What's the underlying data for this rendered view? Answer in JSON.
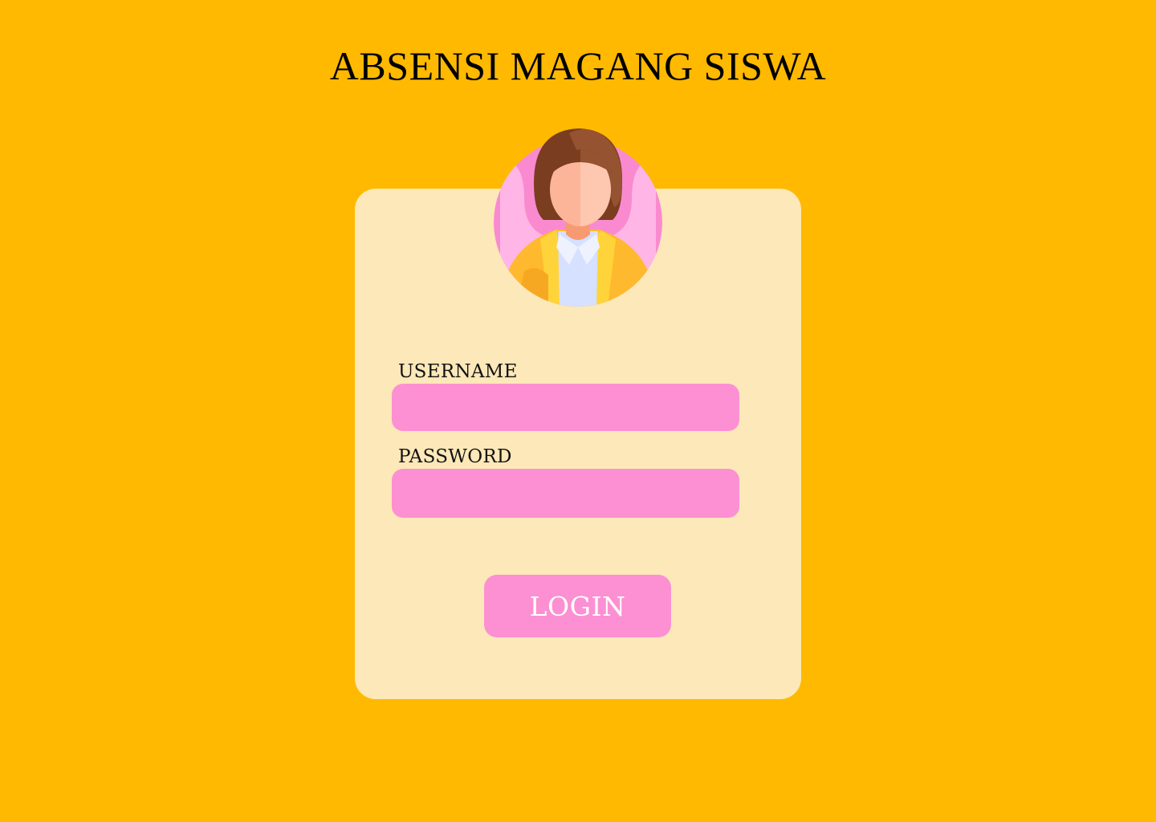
{
  "header": {
    "title": "ABSENSI MAGANG SISWA"
  },
  "login_form": {
    "avatar_icon": "female-student-avatar-icon",
    "username": {
      "label": "USERNAME",
      "value": "",
      "placeholder": ""
    },
    "password": {
      "label": "PASSWORD",
      "value": "",
      "placeholder": ""
    },
    "login_label": "LOGIN"
  },
  "colors": {
    "background": "#FFB900",
    "card": "#FCE8B8",
    "field": "#FC90D2",
    "button": "#FC90D2",
    "button_text": "#FFFFFF",
    "text": "#000000"
  }
}
